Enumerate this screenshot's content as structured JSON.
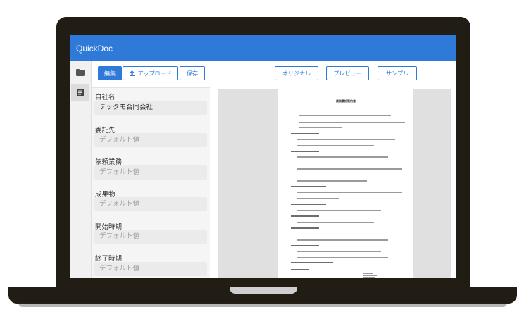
{
  "app": {
    "title": "QuickDoc"
  },
  "rail": {
    "items": [
      {
        "icon": "folder-icon"
      },
      {
        "icon": "document-icon"
      }
    ]
  },
  "toolbar": {
    "edit_label": "編集",
    "upload_label": "アップロード",
    "upload_icon": "upload-icon",
    "save_label": "保存"
  },
  "fields": [
    {
      "label": "自社名",
      "value": "テックモ合同会社",
      "placeholder": "デフォルト値"
    },
    {
      "label": "委託先",
      "value": "",
      "placeholder": "デフォルト値"
    },
    {
      "label": "依頼業務",
      "value": "",
      "placeholder": "デフォルト値"
    },
    {
      "label": "成果物",
      "value": "",
      "placeholder": "デフォルト値"
    },
    {
      "label": "開始時期",
      "value": "",
      "placeholder": "デフォルト値"
    },
    {
      "label": "終了時期",
      "value": "",
      "placeholder": "デフォルト値"
    }
  ],
  "view_tabs": {
    "original": "オリジナル",
    "preview": "プレビュー",
    "sample": "サンプル"
  },
  "document": {
    "title": "業務委託契約書"
  },
  "colors": {
    "accent": "#2f7ad9",
    "frame": "#211d14",
    "panel_bg": "#f5f5f5"
  }
}
